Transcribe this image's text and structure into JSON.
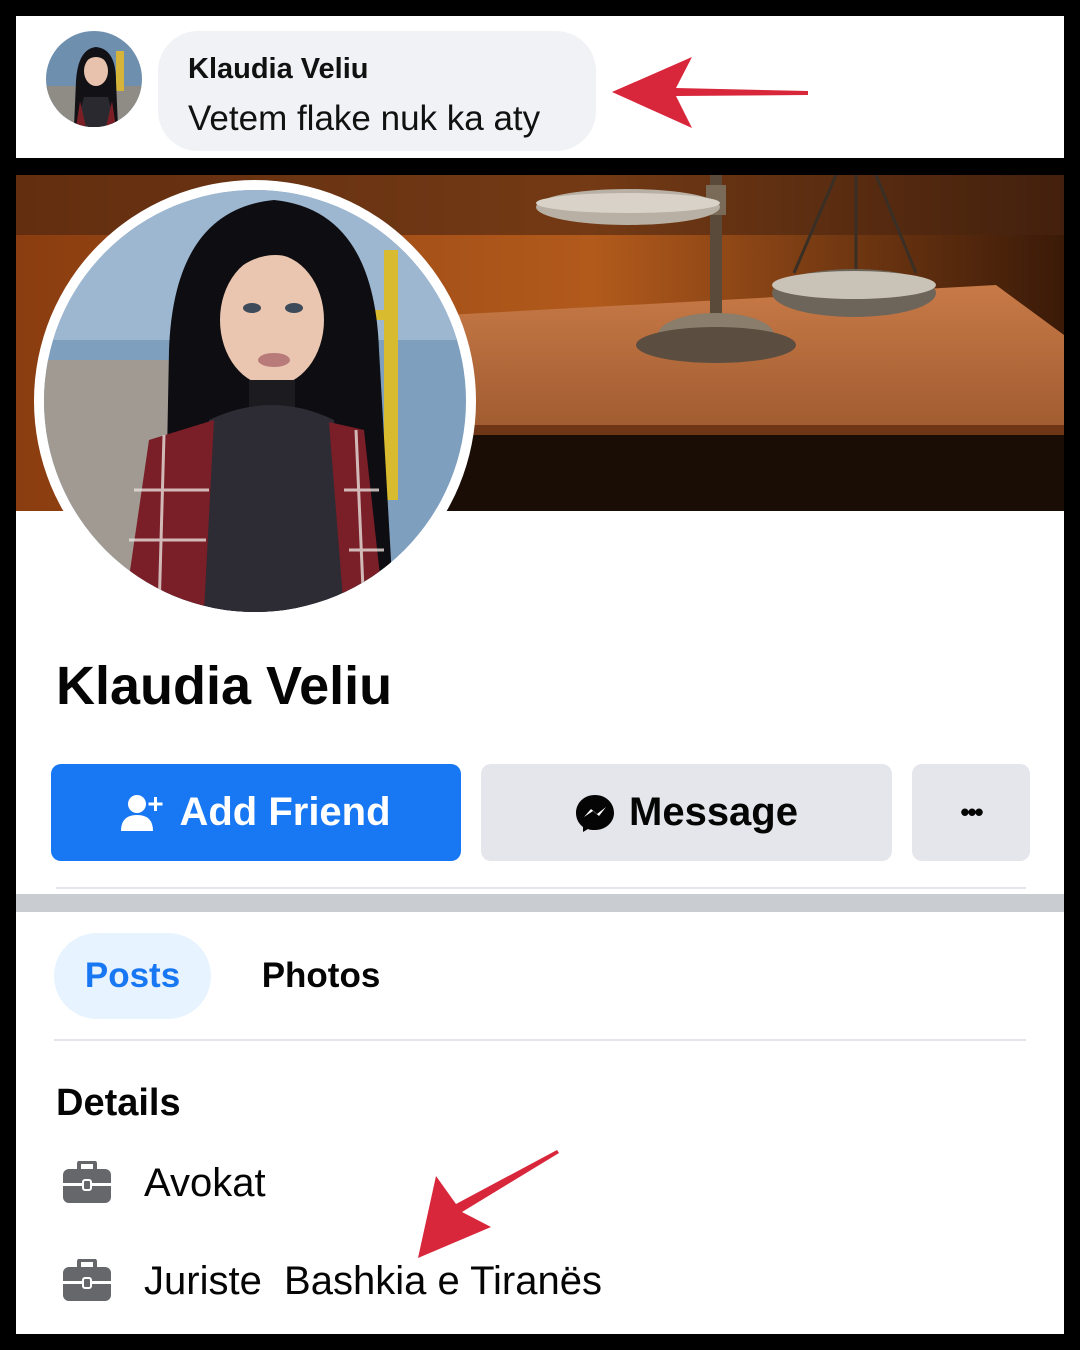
{
  "comment": {
    "author": "Klaudia Veliu",
    "text": "Vetem flake nuk ka aty"
  },
  "profile": {
    "name": "Klaudia Veliu",
    "actions": {
      "add_friend": "Add Friend",
      "message": "Message",
      "more": "•••"
    },
    "tabs": [
      {
        "label": "Posts",
        "active": true
      },
      {
        "label": "Photos",
        "active": false
      }
    ],
    "details": {
      "heading": "Details",
      "items": [
        {
          "icon": "briefcase-icon",
          "text": "Avokat"
        },
        {
          "icon": "briefcase-icon",
          "text": "Juriste  Bashkia e Tiranës"
        }
      ]
    }
  },
  "colors": {
    "primary_blue": "#1877f2",
    "button_gray": "#e4e6eb",
    "tab_active_bg": "#e7f3ff",
    "annotation_arrow": "#d8263b"
  }
}
